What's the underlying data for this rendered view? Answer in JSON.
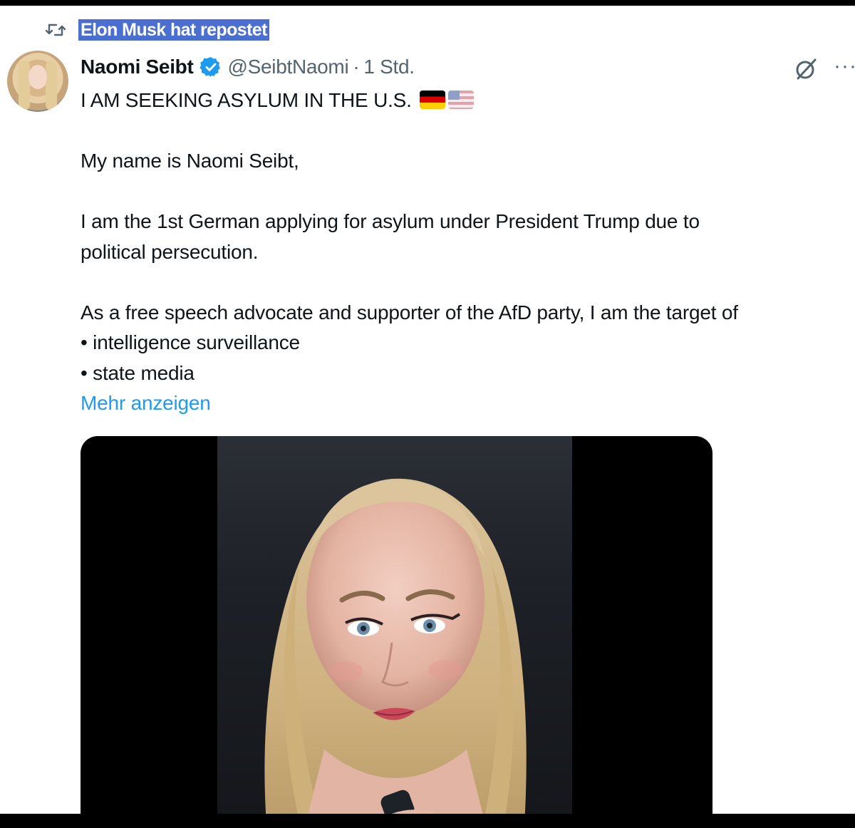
{
  "repost": {
    "icon": "repost-icon",
    "text": "Elon Musk hat repostet"
  },
  "author": {
    "display_name": "Naomi Seibt",
    "handle": "@SeibtNaomi",
    "separator": "·",
    "time": "1 Std.",
    "verified_icon": "verified-badge-icon",
    "avatar": "profile-photo"
  },
  "actions": {
    "grok_icon": "grok-icon",
    "more_icon": "more-options-icon",
    "more_glyph": "···"
  },
  "tweet": {
    "line1": "I AM SEEKING ASYLUM IN THE U.S.",
    "flags": [
      "german-flag",
      "us-flag"
    ],
    "line2": "My name is Naomi Seibt,",
    "line3": "I am the 1st German applying for asylum under President Trump due to",
    "line4": "political persecution.",
    "line5": "As a free speech advocate and supporter of the AfD party, I am the target of",
    "bullet1": "• intelligence surveillance",
    "bullet2": "• state media",
    "show_more": "Mehr anzeigen"
  },
  "media": {
    "type": "video-thumbnail"
  },
  "colors": {
    "link": "#1d9bf0",
    "secondary_text": "#536471",
    "verified": "#1d9bf0",
    "highlight": "#4a6fd1"
  }
}
